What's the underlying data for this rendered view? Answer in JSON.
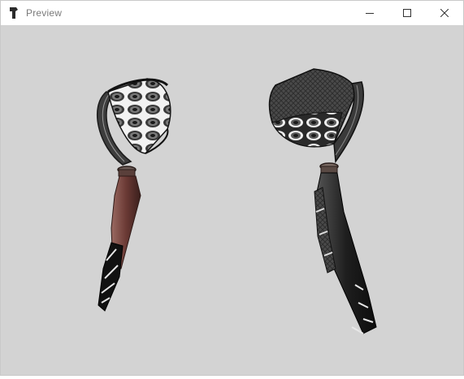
{
  "window": {
    "title": "Preview",
    "icon": "app-icon",
    "controls": [
      "minimize-icon",
      "maximize-icon",
      "close-icon"
    ]
  },
  "viewport": {
    "background": "#d3d3d3",
    "objects": [
      {
        "name": "left-pipe-model",
        "bowl_pattern": "white-with-dark-rings",
        "stem_color": "#6b3a35"
      },
      {
        "name": "right-pipe-model",
        "bowl_pattern": "dark-with-white-rings",
        "stem_color": "#1e1e1e"
      }
    ]
  }
}
